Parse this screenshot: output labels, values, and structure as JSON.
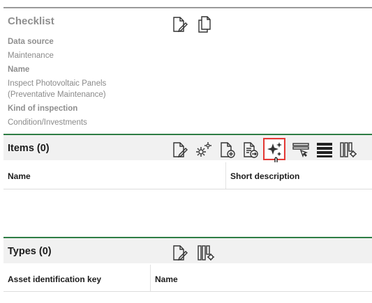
{
  "checklist": {
    "title": "Checklist",
    "fields": [
      {
        "label": "Data source",
        "value": "Maintenance"
      },
      {
        "label": "Name",
        "value_lines": [
          "Inspect Photovoltaic Panels",
          "(Preventative Maintenance)"
        ]
      },
      {
        "label": "Kind of inspection",
        "value": "Condition/Investments"
      }
    ],
    "toolbar_icons": [
      "edit-document-icon",
      "copy-document-icon"
    ]
  },
  "items": {
    "title": "Items (0)",
    "toolbar_icons": [
      "edit-document-icon",
      "settings-gears-icon",
      "add-document-icon",
      "import-document-icon",
      "sparkle-generate-icon",
      "filter-icon",
      "rows-list-icon",
      "column-settings-icon"
    ],
    "highlighted_icon": "sparkle-generate-icon",
    "columns": [
      "Name",
      "Short description"
    ],
    "rows": []
  },
  "types": {
    "title": "Types (0)",
    "toolbar_icons": [
      "edit-document-icon",
      "column-settings-icon"
    ],
    "columns": [
      "Asset identification key",
      "Name"
    ],
    "rows": []
  },
  "colors": {
    "accent_green": "#2e7d45",
    "highlight_red": "#e53935",
    "muted_text": "#8f8f8f"
  }
}
